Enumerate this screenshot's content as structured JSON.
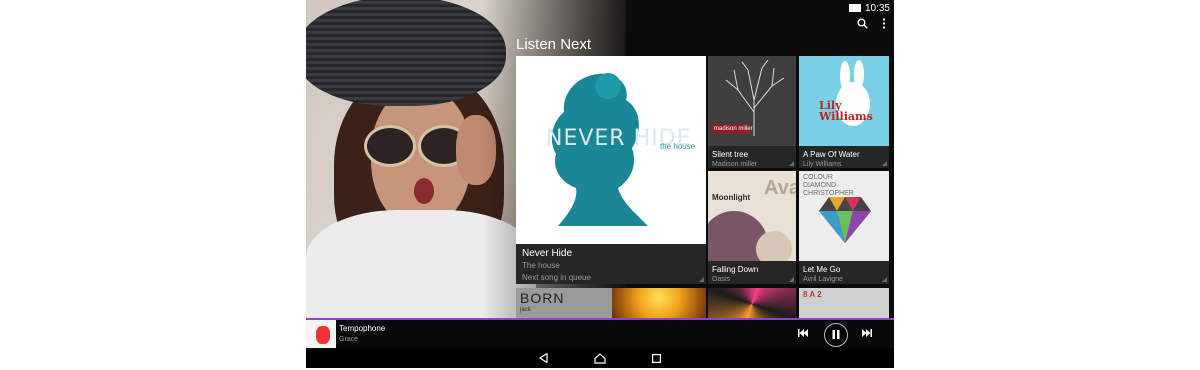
{
  "status_bar": {
    "time": "10:35"
  },
  "header": {
    "title": "Listen Next",
    "search_icon": "search-icon",
    "overflow_icon": "more-vert-icon"
  },
  "main_tile": {
    "art_title": "NEVER HIDE",
    "art_subtitle": "the house",
    "title": "Never Hide",
    "artist": "The house",
    "note": "Next song in queue"
  },
  "tiles": [
    {
      "title": "Silent tree",
      "artist": "Madison miller",
      "art_text": "madison miller"
    },
    {
      "title": "A Paw Of Water",
      "artist": "Lily Williams",
      "art_text": "Lily\nWilliams"
    },
    {
      "title": "Falling Down",
      "artist": "Oasis",
      "art_text_1": "Moonlight",
      "art_text_2": "Ava"
    },
    {
      "title": "Let Me Go",
      "artist": "Avril Lavigne",
      "art_text": "COLOUR\nDIAMOND\nCHRISTOPHER"
    }
  ],
  "bottom_tiles": [
    {
      "art_text": "BORN",
      "art_small": "jack"
    },
    {
      "art_text": ""
    },
    {
      "art_text": ""
    },
    {
      "art_text": "8 A 2"
    }
  ],
  "now_playing": {
    "title": "Tempophone",
    "artist": "Grace"
  },
  "controls": {
    "prev_icon": "skip-previous-icon",
    "pause_icon": "pause-icon",
    "next_icon": "skip-next-icon"
  },
  "nav": {
    "back_icon": "back-icon",
    "home_icon": "home-icon",
    "recents_icon": "recents-icon"
  },
  "colors": {
    "accent": "#8d44c9",
    "background": "#0b0b0b"
  }
}
